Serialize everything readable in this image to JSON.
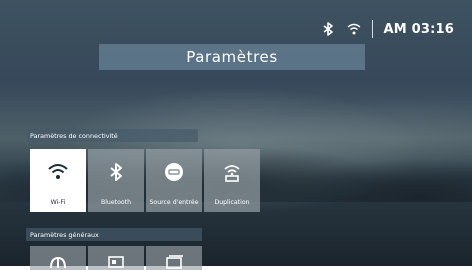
{
  "status_bar": {
    "bluetooth_icon": "bluetooth-icon",
    "wifi_icon": "wifi-icon",
    "time": "AM 03:16"
  },
  "header": {
    "title": "Paramètres"
  },
  "connectivity": {
    "title": "Paramètres de connectivité",
    "tiles": [
      {
        "label": "Wi-Fi",
        "icon": "wifi-icon",
        "selected": true
      },
      {
        "label": "Bluetooth",
        "icon": "bluetooth-icon",
        "selected": false
      },
      {
        "label": "Source d'entrée",
        "icon": "input-source-icon",
        "selected": false
      },
      {
        "label": "Duplication",
        "icon": "screen-mirroring-icon",
        "selected": false
      }
    ]
  },
  "general": {
    "title": "Paramètres généraux",
    "tiles": [
      {
        "icon": "general-settings-icon"
      },
      {
        "icon": "display-icon"
      },
      {
        "icon": "window-icon"
      }
    ]
  },
  "colors": {
    "tile_bg": "#96a0a5",
    "tile_selected_bg": "#ffffff",
    "title_bar_bg": "#7896aa"
  }
}
